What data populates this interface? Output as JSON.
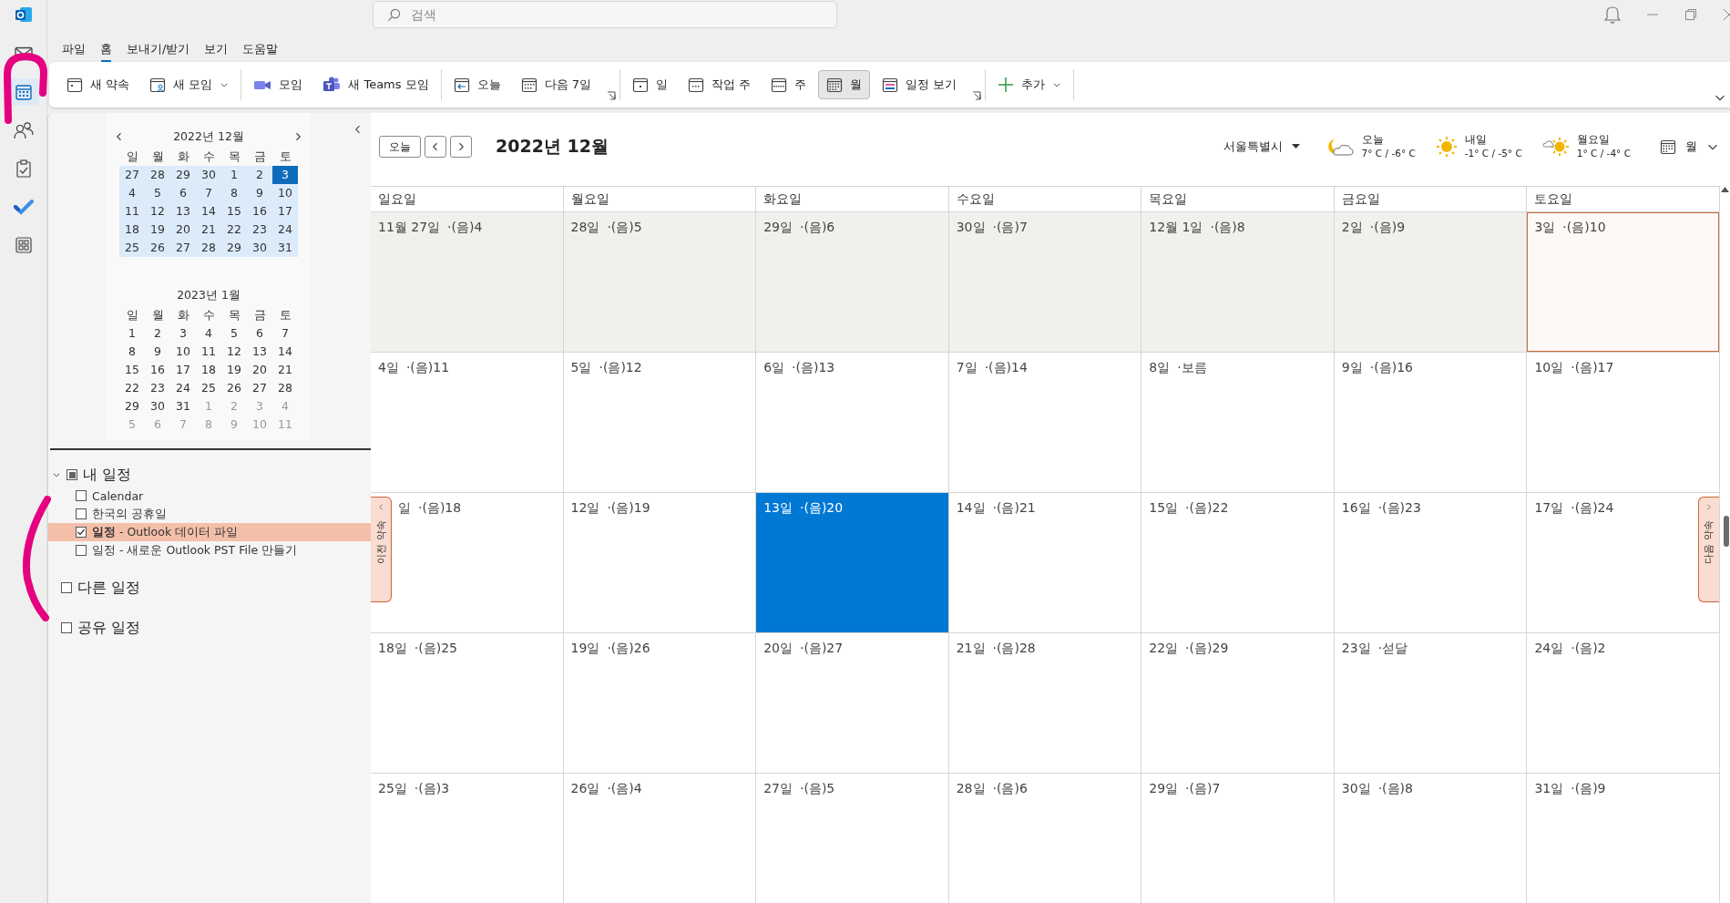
{
  "search": {
    "placeholder": "검색"
  },
  "menu_tabs": [
    {
      "label": "파일",
      "selected": false
    },
    {
      "label": "홈",
      "selected": true
    },
    {
      "label": "보내기/받기",
      "selected": false
    },
    {
      "label": "보기",
      "selected": false
    },
    {
      "label": "도움말",
      "selected": false
    }
  ],
  "ribbon": {
    "groups": [
      {
        "launcher": false,
        "items": [
          {
            "label": "새 약속",
            "dropdown": false,
            "selected": false
          },
          {
            "label": "새 모임",
            "dropdown": true,
            "selected": false
          }
        ]
      },
      {
        "launcher": false,
        "items": [
          {
            "label": "모임",
            "dropdown": false,
            "selected": false
          },
          {
            "label": "새 Teams 모임",
            "dropdown": false,
            "selected": false
          }
        ]
      },
      {
        "launcher": true,
        "items": [
          {
            "label": "오늘",
            "dropdown": false,
            "selected": false
          },
          {
            "label": "다음 7일",
            "dropdown": false,
            "selected": false
          }
        ]
      },
      {
        "launcher": true,
        "items": [
          {
            "label": "일",
            "dropdown": false,
            "selected": false
          },
          {
            "label": "작업 주",
            "dropdown": false,
            "selected": false
          },
          {
            "label": "주",
            "dropdown": false,
            "selected": false
          },
          {
            "label": "월",
            "dropdown": false,
            "selected": true
          },
          {
            "label": "일정 보기",
            "dropdown": false,
            "selected": false
          }
        ]
      },
      {
        "launcher": false,
        "items": [
          {
            "label": "추가",
            "dropdown": true,
            "selected": false
          }
        ]
      }
    ]
  },
  "mini_calendars": [
    {
      "title": "2022년 12월",
      "nav_arrows": true,
      "in_view": true,
      "weekdays": [
        "일",
        "월",
        "화",
        "수",
        "목",
        "금",
        "토"
      ],
      "weeks": [
        [
          {
            "t": "27",
            "dim": false,
            "selected": false
          },
          {
            "t": "28",
            "dim": false,
            "selected": false
          },
          {
            "t": "29",
            "dim": false,
            "selected": false
          },
          {
            "t": "30",
            "dim": false,
            "selected": false
          },
          {
            "t": "1",
            "dim": false,
            "selected": false
          },
          {
            "t": "2",
            "dim": false,
            "selected": false
          },
          {
            "t": "3",
            "dim": false,
            "selected": true
          }
        ],
        [
          {
            "t": "4",
            "dim": false,
            "selected": false
          },
          {
            "t": "5",
            "dim": false,
            "selected": false
          },
          {
            "t": "6",
            "dim": false,
            "selected": false
          },
          {
            "t": "7",
            "dim": false,
            "selected": false
          },
          {
            "t": "8",
            "dim": false,
            "selected": false
          },
          {
            "t": "9",
            "dim": false,
            "selected": false
          },
          {
            "t": "10",
            "dim": false,
            "selected": false
          }
        ],
        [
          {
            "t": "11",
            "dim": false,
            "selected": false
          },
          {
            "t": "12",
            "dim": false,
            "selected": false
          },
          {
            "t": "13",
            "dim": false,
            "selected": false
          },
          {
            "t": "14",
            "dim": false,
            "selected": false
          },
          {
            "t": "15",
            "dim": false,
            "selected": false
          },
          {
            "t": "16",
            "dim": false,
            "selected": false
          },
          {
            "t": "17",
            "dim": false,
            "selected": false
          }
        ],
        [
          {
            "t": "18",
            "dim": false,
            "selected": false
          },
          {
            "t": "19",
            "dim": false,
            "selected": false
          },
          {
            "t": "20",
            "dim": false,
            "selected": false
          },
          {
            "t": "21",
            "dim": false,
            "selected": false
          },
          {
            "t": "22",
            "dim": false,
            "selected": false
          },
          {
            "t": "23",
            "dim": false,
            "selected": false
          },
          {
            "t": "24",
            "dim": false,
            "selected": false
          }
        ],
        [
          {
            "t": "25",
            "dim": false,
            "selected": false
          },
          {
            "t": "26",
            "dim": false,
            "selected": false
          },
          {
            "t": "27",
            "dim": false,
            "selected": false
          },
          {
            "t": "28",
            "dim": false,
            "selected": false
          },
          {
            "t": "29",
            "dim": false,
            "selected": false
          },
          {
            "t": "30",
            "dim": false,
            "selected": false
          },
          {
            "t": "31",
            "dim": false,
            "selected": false
          }
        ]
      ]
    },
    {
      "title": "2023년 1월",
      "nav_arrows": false,
      "in_view": false,
      "weekdays": [
        "일",
        "월",
        "화",
        "수",
        "목",
        "금",
        "토"
      ],
      "weeks": [
        [
          {
            "t": "1",
            "dim": false,
            "selected": false
          },
          {
            "t": "2",
            "dim": false,
            "selected": false
          },
          {
            "t": "3",
            "dim": false,
            "selected": false
          },
          {
            "t": "4",
            "dim": false,
            "selected": false
          },
          {
            "t": "5",
            "dim": false,
            "selected": false
          },
          {
            "t": "6",
            "dim": false,
            "selected": false
          },
          {
            "t": "7",
            "dim": false,
            "selected": false
          }
        ],
        [
          {
            "t": "8",
            "dim": false,
            "selected": false
          },
          {
            "t": "9",
            "dim": false,
            "selected": false
          },
          {
            "t": "10",
            "dim": false,
            "selected": false
          },
          {
            "t": "11",
            "dim": false,
            "selected": false
          },
          {
            "t": "12",
            "dim": false,
            "selected": false
          },
          {
            "t": "13",
            "dim": false,
            "selected": false
          },
          {
            "t": "14",
            "dim": false,
            "selected": false
          }
        ],
        [
          {
            "t": "15",
            "dim": false,
            "selected": false
          },
          {
            "t": "16",
            "dim": false,
            "selected": false
          },
          {
            "t": "17",
            "dim": false,
            "selected": false
          },
          {
            "t": "18",
            "dim": false,
            "selected": false
          },
          {
            "t": "19",
            "dim": false,
            "selected": false
          },
          {
            "t": "20",
            "dim": false,
            "selected": false
          },
          {
            "t": "21",
            "dim": false,
            "selected": false
          }
        ],
        [
          {
            "t": "22",
            "dim": false,
            "selected": false
          },
          {
            "t": "23",
            "dim": false,
            "selected": false
          },
          {
            "t": "24",
            "dim": false,
            "selected": false
          },
          {
            "t": "25",
            "dim": false,
            "selected": false
          },
          {
            "t": "26",
            "dim": false,
            "selected": false
          },
          {
            "t": "27",
            "dim": false,
            "selected": false
          },
          {
            "t": "28",
            "dim": false,
            "selected": false
          }
        ],
        [
          {
            "t": "29",
            "dim": false,
            "selected": false
          },
          {
            "t": "30",
            "dim": false,
            "selected": false
          },
          {
            "t": "31",
            "dim": false,
            "selected": false
          },
          {
            "t": "1",
            "dim": true,
            "selected": false
          },
          {
            "t": "2",
            "dim": true,
            "selected": false
          },
          {
            "t": "3",
            "dim": true,
            "selected": false
          },
          {
            "t": "4",
            "dim": true,
            "selected": false
          }
        ],
        [
          {
            "t": "5",
            "dim": true,
            "selected": false
          },
          {
            "t": "6",
            "dim": true,
            "selected": false
          },
          {
            "t": "7",
            "dim": true,
            "selected": false
          },
          {
            "t": "8",
            "dim": true,
            "selected": false
          },
          {
            "t": "9",
            "dim": true,
            "selected": false
          },
          {
            "t": "10",
            "dim": true,
            "selected": false
          },
          {
            "t": "11",
            "dim": true,
            "selected": false
          }
        ]
      ]
    }
  ],
  "calendar_list": {
    "groups": [
      {
        "name": "내 일정",
        "expanded": true,
        "checked": false,
        "partial": true,
        "items": [
          {
            "label": "Calendar",
            "checked": false,
            "selected": false
          },
          {
            "label": "한국의 공휴일",
            "checked": false,
            "selected": false
          },
          {
            "label": "**일정** - Outlook 데이터 파일",
            "checked": true,
            "selected": true
          },
          {
            "label": "일정 - 새로운 Outlook PST File 만들기",
            "checked": false,
            "selected": false
          }
        ]
      },
      {
        "name": "다른 일정",
        "expanded": false,
        "checked": false,
        "partial": false
      },
      {
        "name": "공유 일정",
        "expanded": false,
        "checked": false,
        "partial": false
      }
    ]
  },
  "calendar_header": {
    "today_button": "오늘",
    "title": "2022년 12월",
    "location": "서울특별시",
    "forecasts": [
      {
        "day": "오늘",
        "temps": "7° C / -6° C"
      },
      {
        "day": "내일",
        "temps": "-1° C / -5° C"
      },
      {
        "day": "월요일",
        "temps": "1° C / -4° C"
      }
    ],
    "view": "월"
  },
  "month_view": {
    "weekdays": [
      "일요일",
      "월요일",
      "화요일",
      "수요일",
      "목요일",
      "금요일",
      "토요일"
    ],
    "prev_tab": "이전 약속",
    "next_tab": "다음 약속",
    "weeks": [
      [
        {
          "date": "11월 27일",
          "lunar": "·(음)4",
          "shaded": true,
          "selected": false,
          "today": false
        },
        {
          "date": "28일",
          "lunar": "·(음)5",
          "shaded": true,
          "selected": false,
          "today": false
        },
        {
          "date": "29일",
          "lunar": "·(음)6",
          "shaded": true,
          "selected": false,
          "today": false
        },
        {
          "date": "30일",
          "lunar": "·(음)7",
          "shaded": true,
          "selected": false,
          "today": false
        },
        {
          "date": "12월 1일",
          "lunar": "·(음)8",
          "shaded": true,
          "selected": false,
          "today": false
        },
        {
          "date": "2일",
          "lunar": "·(음)9",
          "shaded": true,
          "selected": false,
          "today": false
        },
        {
          "date": "3일",
          "lunar": "·(음)10",
          "shaded": true,
          "selected": true,
          "today": false
        }
      ],
      [
        {
          "date": "4일",
          "lunar": "·(음)11",
          "shaded": false,
          "selected": false,
          "today": false
        },
        {
          "date": "5일",
          "lunar": "·(음)12",
          "shaded": false,
          "selected": false,
          "today": false
        },
        {
          "date": "6일",
          "lunar": "·(음)13",
          "shaded": false,
          "selected": false,
          "today": false
        },
        {
          "date": "7일",
          "lunar": "·(음)14",
          "shaded": false,
          "selected": false,
          "today": false
        },
        {
          "date": "8일",
          "lunar": "·보름",
          "shaded": false,
          "selected": false,
          "today": false
        },
        {
          "date": "9일",
          "lunar": "·(음)16",
          "shaded": false,
          "selected": false,
          "today": false
        },
        {
          "date": "10일",
          "lunar": "·(음)17",
          "shaded": false,
          "selected": false,
          "today": false
        }
      ],
      [
        {
          "date": "일",
          "lunar": "·(음)18",
          "shaded": false,
          "selected": false,
          "today": false
        },
        {
          "date": "12일",
          "lunar": "·(음)19",
          "shaded": false,
          "selected": false,
          "today": false
        },
        {
          "date": "13일",
          "lunar": "·(음)20",
          "shaded": false,
          "selected": false,
          "today": true
        },
        {
          "date": "14일",
          "lunar": "·(음)21",
          "shaded": false,
          "selected": false,
          "today": false
        },
        {
          "date": "15일",
          "lunar": "·(음)22",
          "shaded": false,
          "selected": false,
          "today": false
        },
        {
          "date": "16일",
          "lunar": "·(음)23",
          "shaded": false,
          "selected": false,
          "today": false
        },
        {
          "date": "17일",
          "lunar": "·(음)24",
          "shaded": false,
          "selected": false,
          "today": false
        }
      ],
      [
        {
          "date": "18일",
          "lunar": "·(음)25",
          "shaded": false,
          "selected": false,
          "today": false
        },
        {
          "date": "19일",
          "lunar": "·(음)26",
          "shaded": false,
          "selected": false,
          "today": false
        },
        {
          "date": "20일",
          "lunar": "·(음)27",
          "shaded": false,
          "selected": false,
          "today": false
        },
        {
          "date": "21일",
          "lunar": "·(음)28",
          "shaded": false,
          "selected": false,
          "today": false
        },
        {
          "date": "22일",
          "lunar": "·(음)29",
          "shaded": false,
          "selected": false,
          "today": false
        },
        {
          "date": "23일",
          "lunar": "·섣달",
          "shaded": false,
          "selected": false,
          "today": false
        },
        {
          "date": "24일",
          "lunar": "·(음)2",
          "shaded": false,
          "selected": false,
          "today": false
        }
      ],
      [
        {
          "date": "25일",
          "lunar": "·(음)3",
          "shaded": false,
          "selected": false,
          "today": false
        },
        {
          "date": "26일",
          "lunar": "·(음)4",
          "shaded": false,
          "selected": false,
          "today": false
        },
        {
          "date": "27일",
          "lunar": "·(음)5",
          "shaded": false,
          "selected": false,
          "today": false
        },
        {
          "date": "28일",
          "lunar": "·(음)6",
          "shaded": false,
          "selected": false,
          "today": false
        },
        {
          "date": "29일",
          "lunar": "·(음)7",
          "shaded": false,
          "selected": false,
          "today": false
        },
        {
          "date": "30일",
          "lunar": "·(음)8",
          "shaded": false,
          "selected": false,
          "today": false
        },
        {
          "date": "31일",
          "lunar": "·(음)9",
          "shaded": false,
          "selected": false,
          "today": false
        }
      ]
    ]
  }
}
